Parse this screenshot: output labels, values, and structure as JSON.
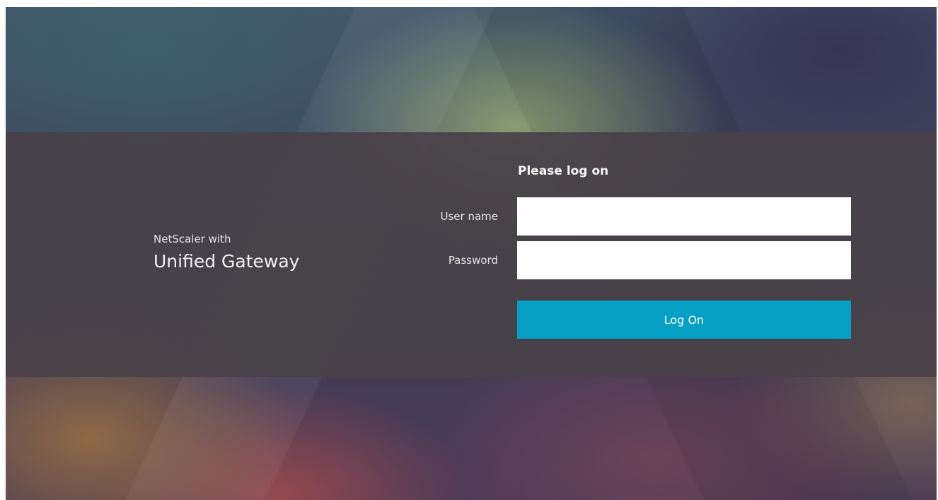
{
  "brand": {
    "line1": "NetScaler with",
    "line2": "Unified Gateway"
  },
  "login": {
    "title": "Please log on",
    "username_label": "User name",
    "username_value": "",
    "password_label": "Password",
    "password_value": "",
    "submit_label": "Log On"
  },
  "colors": {
    "button": "#05a0c4",
    "band": "#484248",
    "input_bg": "#ffffff"
  }
}
